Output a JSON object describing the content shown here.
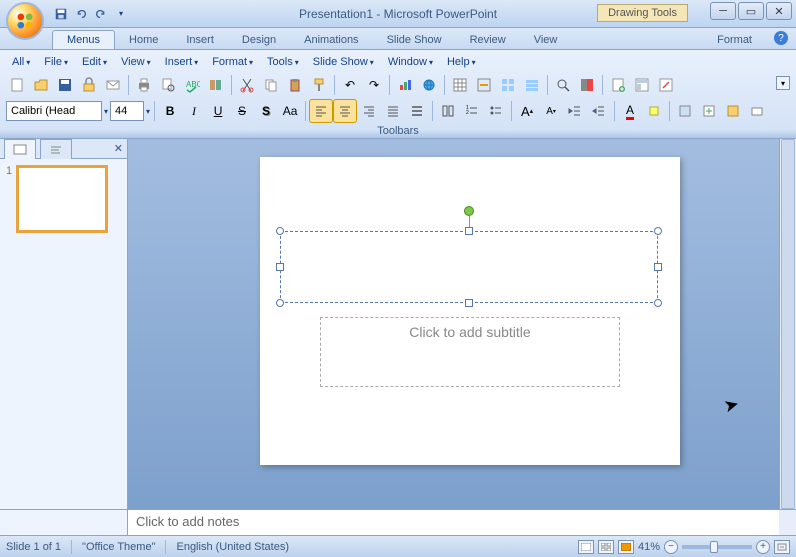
{
  "title": "Presentation1 - Microsoft PowerPoint",
  "drawing_tools_label": "Drawing Tools",
  "tabs": {
    "menus": "Menus",
    "home": "Home",
    "insert": "Insert",
    "design": "Design",
    "animations": "Animations",
    "slideshow": "Slide Show",
    "review": "Review",
    "view": "View",
    "format": "Format"
  },
  "classic_menus": {
    "all": "All",
    "file": "File",
    "edit": "Edit",
    "view": "View",
    "insert": "Insert",
    "format": "Format",
    "tools": "Tools",
    "slideshow": "Slide Show",
    "window": "Window",
    "help": "Help"
  },
  "font": {
    "name": "Calibri (Head",
    "size": "44"
  },
  "ribbon_group_label": "Toolbars",
  "slide": {
    "thumb_number": "1",
    "subtitle_placeholder": "Click to add subtitle"
  },
  "notes_placeholder": "Click to add notes",
  "status": {
    "slide": "Slide 1 of 1",
    "theme": "\"Office Theme\"",
    "language": "English (United States)",
    "zoom": "41%"
  }
}
